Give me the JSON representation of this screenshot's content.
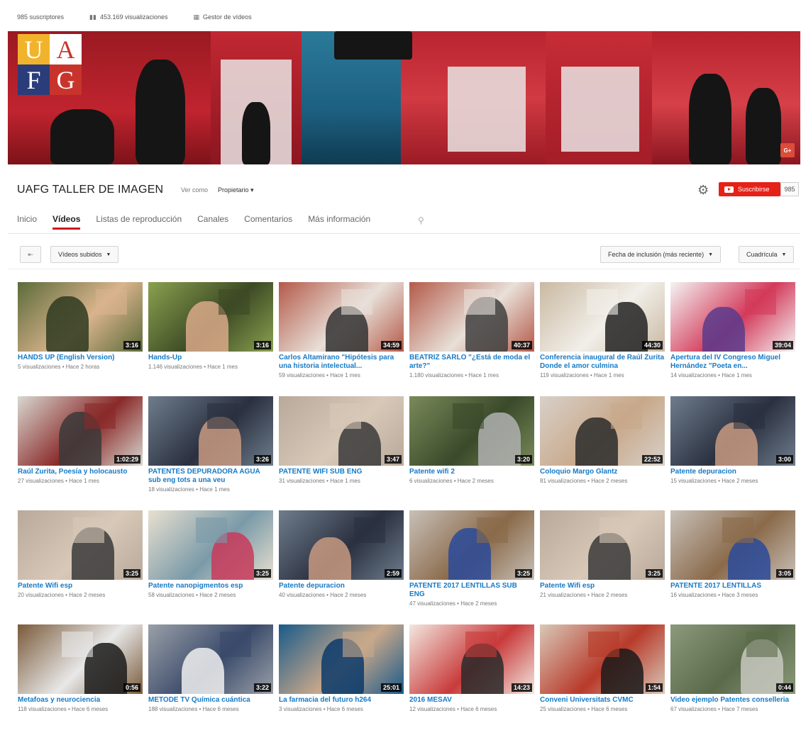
{
  "stats": {
    "subscribers": "985 suscriptores",
    "views": "453.169 visualizaciones",
    "manager": "Gestor de vídeos"
  },
  "banner": {
    "logo": [
      "U",
      "A",
      "F",
      "G"
    ],
    "gplus": "G+"
  },
  "channel": {
    "title": "UAFG TALLER DE IMAGEN",
    "view_as": "Ver como",
    "owner": "Propietario",
    "subscribe": "Suscribirse",
    "sub_count": "985"
  },
  "tabs": [
    "Inicio",
    "Vídeos",
    "Listas de reproducción",
    "Canales",
    "Comentarios",
    "Más información"
  ],
  "toolbar": {
    "uploads": "Vídeos subidos",
    "sort": "Fecha de inclusión (más reciente)",
    "view": "Cuadrícula"
  },
  "videos": [
    {
      "title": "HANDS UP (English Version)",
      "views": "5 visualizaciones",
      "age": "Hace 2 horas",
      "duration": "3:16",
      "colors": [
        "#5c6b3a",
        "#2e3a20",
        "#d9b38c"
      ]
    },
    {
      "title": "Hands-Up",
      "views": "1.146 visualizaciones",
      "age": "Hace 1 mes",
      "duration": "3:16",
      "colors": [
        "#8aa14f",
        "#d9a98a",
        "#3d4a25"
      ]
    },
    {
      "title": "Carlos Altamirano \"Hipótesis para una historia intelectual...",
      "views": "59 visualizaciones",
      "age": "Hace 1 mes",
      "duration": "34:59",
      "colors": [
        "#b45a4a",
        "#333333",
        "#e8e0d8"
      ]
    },
    {
      "title": "BEATRIZ SARLO \"¿Está de moda el arte?\"",
      "views": "1.180 visualizaciones",
      "age": "Hace 1 mes",
      "duration": "40:37",
      "colors": [
        "#b45a4a",
        "#404040",
        "#e8e0d8"
      ]
    },
    {
      "title": "Conferencia inaugural de Raúl Zurita Donde el amor culmina",
      "views": "119 visualizaciones",
      "age": "Hace 1 mes",
      "duration": "44:30",
      "colors": [
        "#c9b9a2",
        "#222222",
        "#f2efe9"
      ]
    },
    {
      "title": "Apertura del IV Congreso Miguel Hernández \"Poeta en...",
      "views": "14 visualizaciones",
      "age": "Hace 1 mes",
      "duration": "39:04",
      "colors": [
        "#f4f4f4",
        "#5a3b8c",
        "#d33a5a"
      ]
    },
    {
      "title": "Raúl Zurita, Poesía y holocausto",
      "views": "27 visualizaciones",
      "age": "Hace 1 mes",
      "duration": "1:02:29",
      "colors": [
        "#d8d8d0",
        "#3a3a3a",
        "#8a2a2a"
      ]
    },
    {
      "title": "PATENTES DEPURADORA AGUA sub eng tots a una veu",
      "views": "18 visualizaciones",
      "age": "Hace 1 mes",
      "duration": "3:26",
      "colors": [
        "#6f7d8c",
        "#c89a80",
        "#2a3040"
      ]
    },
    {
      "title": "PATENTE WIFI SUB ENG",
      "views": "31 visualizaciones",
      "age": "Hace 1 mes",
      "duration": "3:47",
      "colors": [
        "#b8a99a",
        "#3a3a3a",
        "#d8c8b8"
      ]
    },
    {
      "title": "Patente wifi 2",
      "views": "6 visualizaciones",
      "age": "Hace 2 meses",
      "duration": "3:20",
      "colors": [
        "#7a8a5a",
        "#b0b0b0",
        "#3a4a2a"
      ]
    },
    {
      "title": "Coloquio Margo Glantz",
      "views": "81 visualizaciones",
      "age": "Hace 2 meses",
      "duration": "22:52",
      "colors": [
        "#d8d0c8",
        "#2a2a2a",
        "#c8a88a"
      ]
    },
    {
      "title": "Patente depuracion",
      "views": "15 visualizaciones",
      "age": "Hace 2 meses",
      "duration": "3:00",
      "colors": [
        "#6f7d8c",
        "#c89a80",
        "#2a3040"
      ]
    },
    {
      "title": "Patente Wifi esp",
      "views": "20 visualizaciones",
      "age": "Hace 2 meses",
      "duration": "3:25",
      "colors": [
        "#b8a99a",
        "#3a3a3a",
        "#d8c8b8"
      ]
    },
    {
      "title": "Patente nanopigmentos esp",
      "views": "58 visualizaciones",
      "age": "Hace 2 meses",
      "duration": "3:25",
      "colors": [
        "#e8e0d0",
        "#c83a5a",
        "#7a9aa8"
      ]
    },
    {
      "title": "Patente depuracion",
      "views": "40 visualizaciones",
      "age": "Hace 2 meses",
      "duration": "2:59",
      "colors": [
        "#6f7d8c",
        "#c89a80",
        "#2a3040"
      ]
    },
    {
      "title": "PATENTE 2017 LENTILLAS SUB ENG",
      "views": "47 visualizaciones",
      "age": "Hace 2 meses",
      "duration": "3:25",
      "colors": [
        "#c8c0b8",
        "#2a4a9a",
        "#8a6a4a"
      ]
    },
    {
      "title": "Patente Wifi esp",
      "views": "21 visualizaciones",
      "age": "Hace 2 meses",
      "duration": "3:25",
      "colors": [
        "#b8a99a",
        "#3a3a3a",
        "#d8c8b8"
      ]
    },
    {
      "title": "PATENTE 2017 LENTILLAS",
      "views": "16 visualizaciones",
      "age": "Hace 3 meses",
      "duration": "3:05",
      "colors": [
        "#c8c0b8",
        "#2a4a9a",
        "#8a6a4a"
      ]
    },
    {
      "title": "Metafoas y neurociencia",
      "views": "118 visualizaciones",
      "age": "Hace 6 meses",
      "duration": "0:56",
      "colors": [
        "#7a5a3a",
        "#1a1a1a",
        "#e8e8e8"
      ]
    },
    {
      "title": "METODE TV Química cuántica",
      "views": "188 visualizaciones",
      "age": "Hace 6 meses",
      "duration": "3:22",
      "colors": [
        "#9aa0a8",
        "#f0f0f0",
        "#3a4a6a"
      ]
    },
    {
      "title": "La farmacia del futuro h264",
      "views": "3 visualizaciones",
      "age": "Hace 6 meses",
      "duration": "25:01",
      "colors": [
        "#1a5a8a",
        "#0a3a6a",
        "#c8a88a"
      ]
    },
    {
      "title": "2016 MESAV",
      "views": "12 visualizaciones",
      "age": "Hace 6 meses",
      "duration": "14:23",
      "colors": [
        "#f2e8e0",
        "#2a2a2a",
        "#c83a3a"
      ]
    },
    {
      "title": "Conveni Universitats CVMC",
      "views": "25 visualizaciones",
      "age": "Hace 6 meses",
      "duration": "1:54",
      "colors": [
        "#d8c8b8",
        "#1a1a1a",
        "#b83a2a"
      ]
    },
    {
      "title": "Video ejemplo Patentes conselleria",
      "views": "67 visualizaciones",
      "age": "Hace 7 meses",
      "duration": "0:44",
      "colors": [
        "#8a9a7a",
        "#c8c8c0",
        "#5a6a4a"
      ]
    }
  ]
}
